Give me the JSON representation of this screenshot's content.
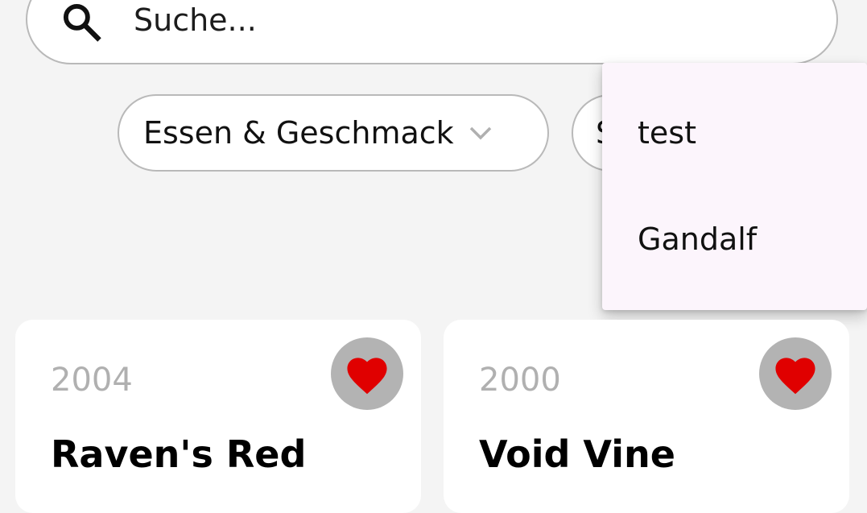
{
  "search": {
    "placeholder": "Suche...",
    "icon": "search-icon"
  },
  "filters": {
    "chip1_label": "Essen & Geschmack",
    "chip2_label": "S",
    "chevron_icon": "chevron-down-icon"
  },
  "menu": {
    "items": [
      {
        "label": "test"
      },
      {
        "label": "Gandalf"
      }
    ]
  },
  "cards": [
    {
      "year": "2004",
      "title": "Raven's Red",
      "favorite": true
    },
    {
      "year": "2000",
      "title": "Void Vine",
      "favorite": true
    }
  ],
  "colors": {
    "background": "#f4f4f4",
    "heart": "#e00000",
    "fav_bg": "#b3b3b3",
    "menu_bg": "#fcf5fc",
    "border": "#b9b9b9",
    "year_text": "#b0b0b0"
  }
}
